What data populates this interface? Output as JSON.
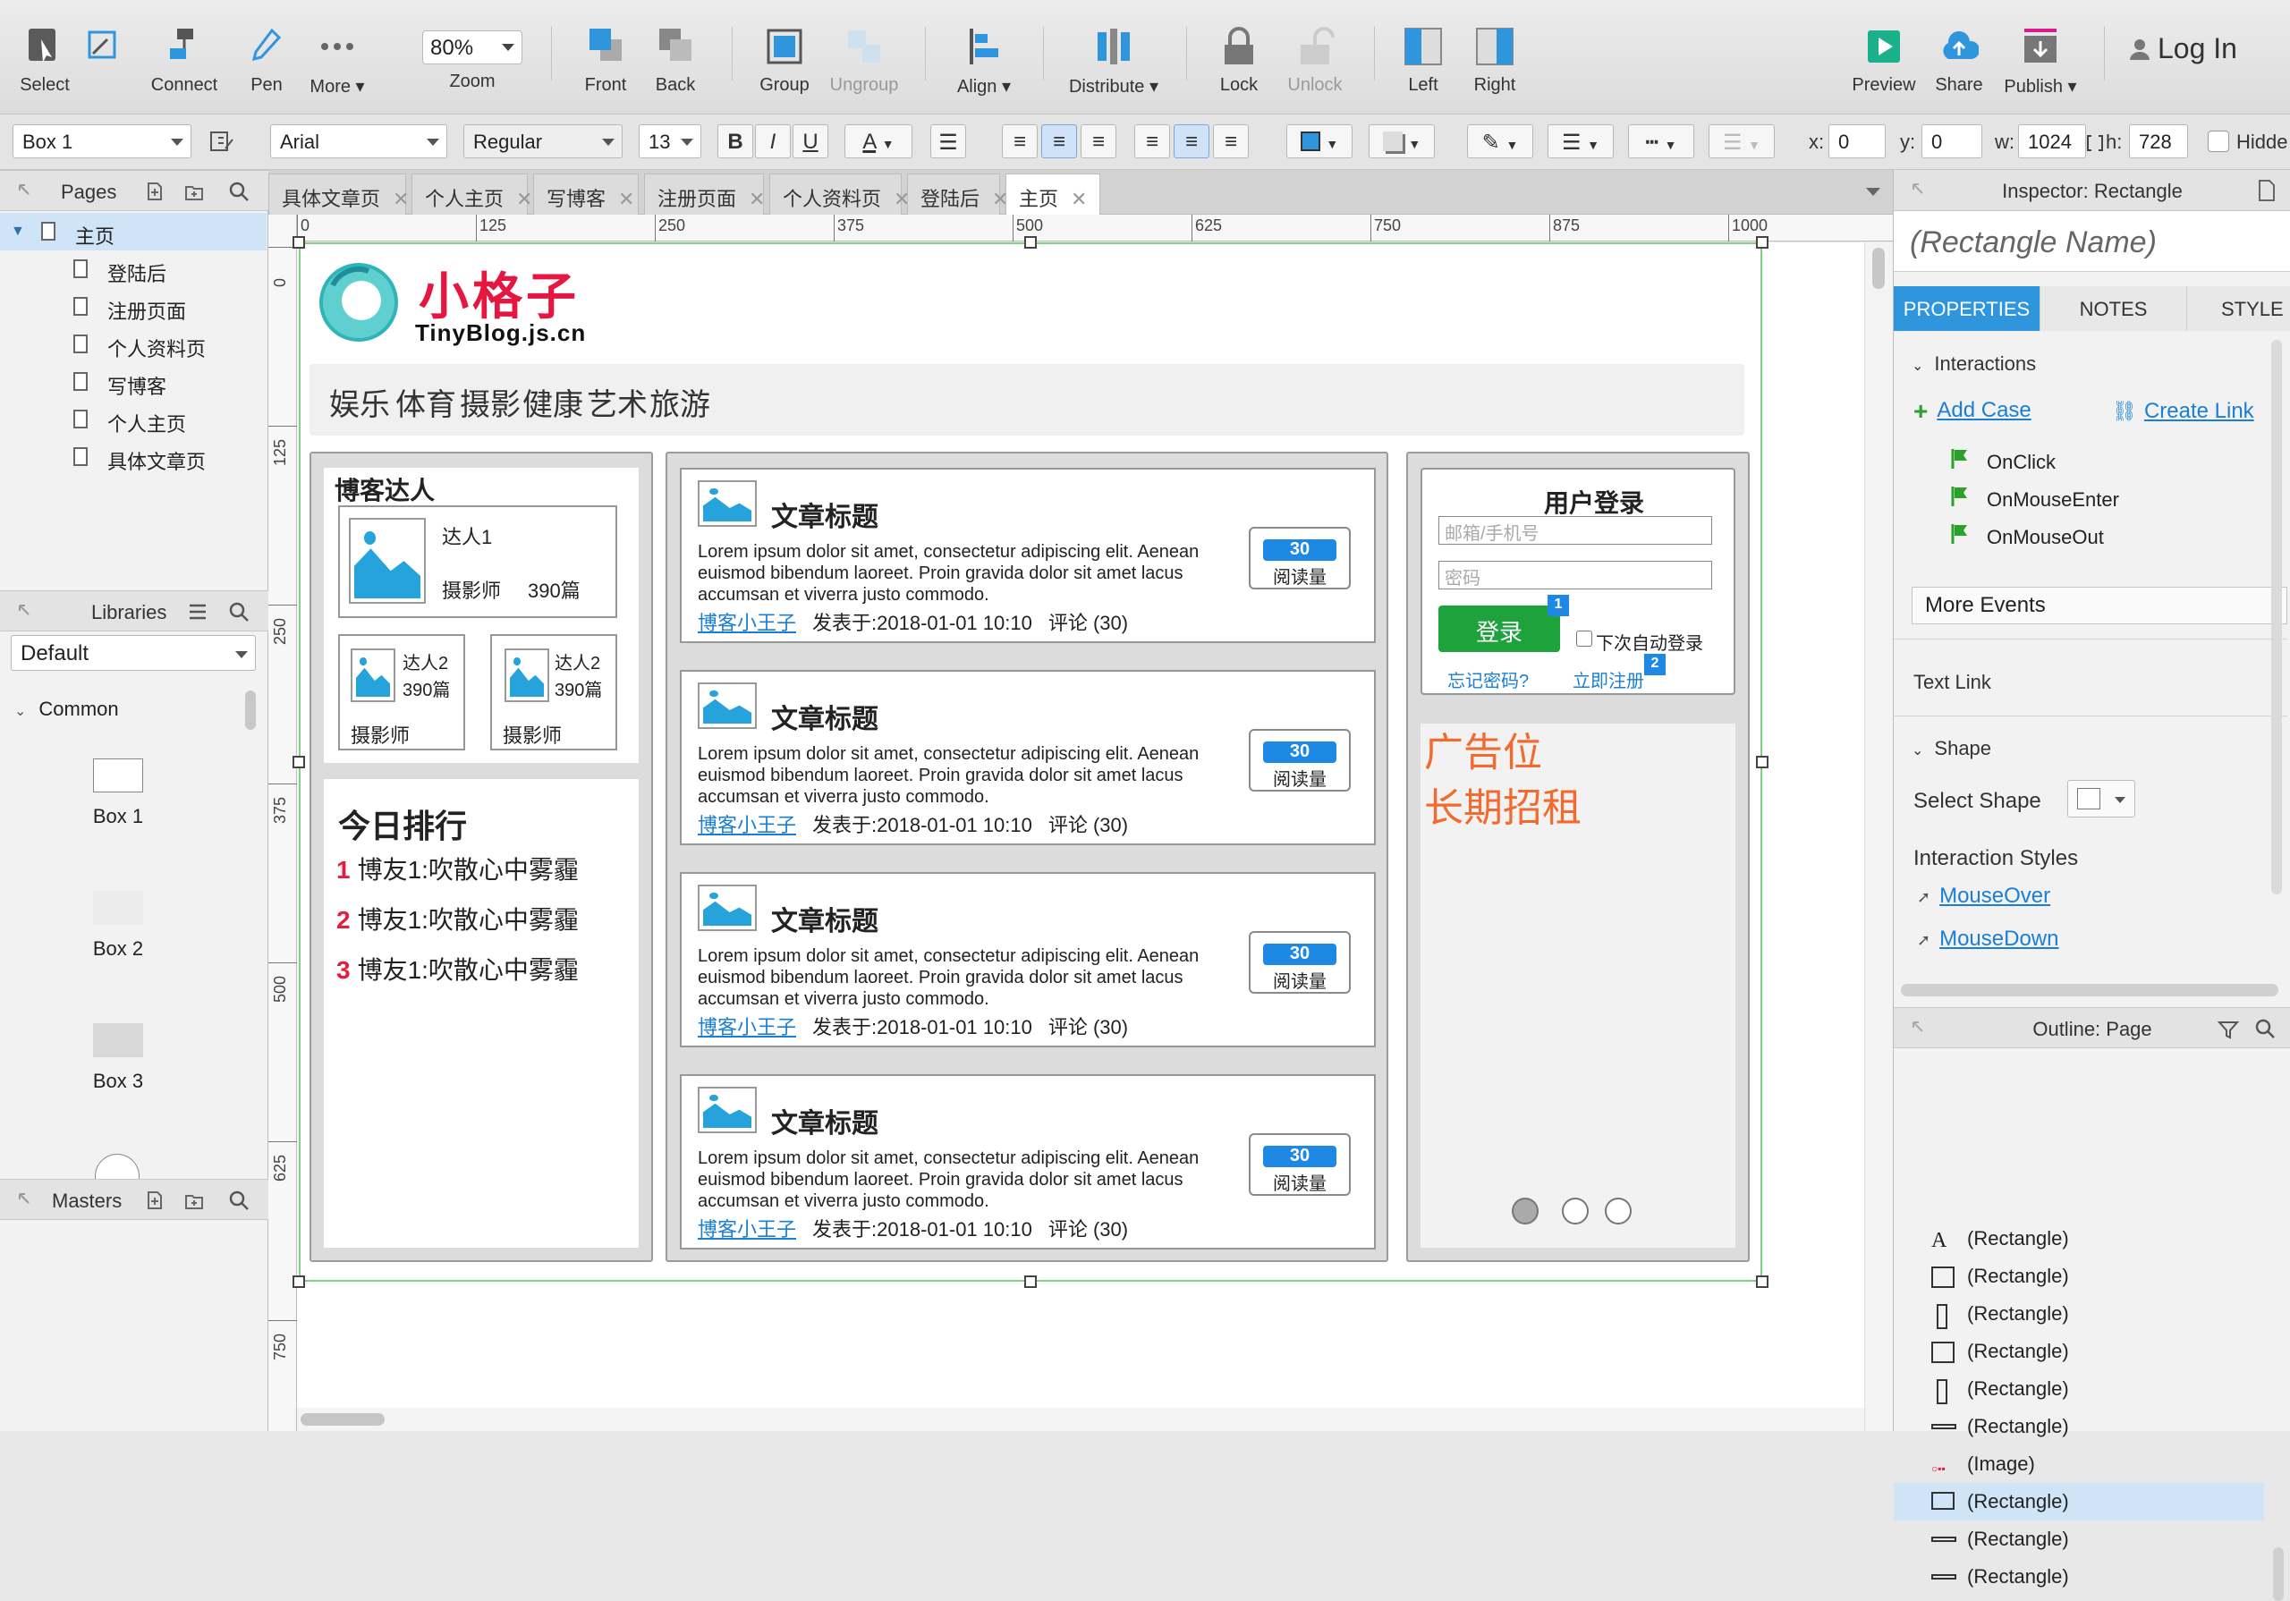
{
  "toolbar": {
    "select": "Select",
    "connect": "Connect",
    "pen": "Pen",
    "more": "More ▾",
    "zoom_value": "80%",
    "zoom_label": "Zoom",
    "front": "Front",
    "back": "Back",
    "group": "Group",
    "ungroup": "Ungroup",
    "align": "Align ▾",
    "distribute": "Distribute ▾",
    "lock": "Lock",
    "unlock": "Unlock",
    "left": "Left",
    "right": "Right",
    "preview": "Preview",
    "share": "Share",
    "publish": "Publish ▾",
    "login": "Log In"
  },
  "format": {
    "widget": "Box 1",
    "font": "Arial",
    "weight": "Regular",
    "size": "13",
    "x_label": "x:",
    "x": "0",
    "y_label": "y:",
    "y": "0",
    "w_label": "w:",
    "w": "1024",
    "h_label": "h:",
    "h": "728",
    "hidden": "Hidde"
  },
  "pages_panel": {
    "title": "Pages",
    "root": "主页",
    "pages": [
      "登陆后",
      "注册页面",
      "个人资料页",
      "写博客",
      "个人主页",
      "具体文章页"
    ]
  },
  "libraries_panel": {
    "title": "Libraries",
    "selected": "Default",
    "group": "Common",
    "widgets": [
      "Box 1",
      "Box 2",
      "Box 3"
    ]
  },
  "masters_panel": {
    "title": "Masters"
  },
  "tabs": [
    "具体文章页",
    "个人主页",
    "写博客",
    "注册页面",
    "个人资料页",
    "登陆后",
    "主页"
  ],
  "ruler": {
    "h": [
      "0",
      "125",
      "250",
      "375",
      "500",
      "625",
      "750",
      "875",
      "1000"
    ],
    "v": [
      "0",
      "125",
      "250",
      "375",
      "500",
      "625",
      "750"
    ]
  },
  "site": {
    "logo_cn": "小格子",
    "logo_en": "TinyBlog.js.cn",
    "nav": [
      "娱乐",
      "体育",
      "摄影",
      "健康",
      "艺术",
      "旅游"
    ],
    "experts_title": "博客达人",
    "expert_main": {
      "name": "达人1",
      "role": "摄影师",
      "count": "390篇"
    },
    "expert_small": [
      {
        "name": "达人2",
        "count": "390篇",
        "role": "摄影师"
      },
      {
        "name": "达人2",
        "count": "390篇",
        "role": "摄影师"
      }
    ],
    "ranking_title": "今日排行",
    "ranking": [
      {
        "num": "1",
        "text": "博友1:吹散心中雾霾"
      },
      {
        "num": "2",
        "text": "博友1:吹散心中雾霾"
      },
      {
        "num": "3",
        "text": "博友1:吹散心中雾霾"
      }
    ],
    "articles": [
      {
        "title": "文章标题",
        "body": "Lorem ipsum dolor sit amet, consectetur adipiscing elit. Aenean euismod bibendum laoreet. Proin gravida dolor sit amet lacus accumsan et viverra justo commodo.",
        "author": "博客小王子",
        "date": "发表于:2018-01-01 10:10",
        "comments": "评论 (30)",
        "reads": "30",
        "reads_label": "阅读量"
      },
      {
        "title": "文章标题",
        "body": "Lorem ipsum dolor sit amet, consectetur adipiscing elit. Aenean euismod bibendum laoreet. Proin gravida dolor sit amet lacus accumsan et viverra justo commodo.",
        "author": "博客小王子",
        "date": "发表于:2018-01-01 10:10",
        "comments": "评论 (30)",
        "reads": "30",
        "reads_label": "阅读量"
      },
      {
        "title": "文章标题",
        "body": "Lorem ipsum dolor sit amet, consectetur adipiscing elit. Aenean euismod bibendum laoreet. Proin gravida dolor sit amet lacus accumsan et viverra justo commodo.",
        "author": "博客小王子",
        "date": "发表于:2018-01-01 10:10",
        "comments": "评论 (30)",
        "reads": "30",
        "reads_label": "阅读量"
      },
      {
        "title": "文章标题",
        "body": "Lorem ipsum dolor sit amet, consectetur adipiscing elit. Aenean euismod bibendum laoreet. Proin gravida dolor sit amet lacus accumsan et viverra justo commodo.",
        "author": "博客小王子",
        "date": "发表于:2018-01-01 10:10",
        "comments": "评论 (30)",
        "reads": "30",
        "reads_label": "阅读量"
      }
    ],
    "login": {
      "title": "用户登录",
      "user_placeholder": "邮箱/手机号",
      "pass_placeholder": "密码",
      "button": "登录",
      "remember": "下次自动登录",
      "forgot": "忘记密码?",
      "register": "立即注册",
      "marker1": "1",
      "marker2": "2"
    },
    "ad": {
      "line1": "广告位",
      "line2": "长期招租"
    }
  },
  "inspector": {
    "title": "Inspector: Rectangle",
    "name_placeholder": "(Rectangle Name)",
    "tabs": [
      "PROPERTIES",
      "NOTES",
      "STYLE"
    ],
    "interactions": "Interactions",
    "add_case": "Add Case",
    "create_link": "Create Link",
    "events": [
      "OnClick",
      "OnMouseEnter",
      "OnMouseOut"
    ],
    "more_events": "More Events",
    "text_link": "Text Link",
    "shape": "Shape",
    "select_shape": "Select Shape",
    "interaction_styles": "Interaction Styles",
    "styles": [
      "MouseOver",
      "MouseDown"
    ]
  },
  "outline": {
    "title": "Outline: Page",
    "items": [
      "(Rectangle)",
      "(Rectangle)",
      "(Rectangle)",
      "(Rectangle)",
      "(Rectangle)",
      "(Rectangle)",
      "(Image)",
      "(Rectangle)",
      "(Rectangle)",
      "(Rectangle)"
    ]
  },
  "colors": {
    "accent": "#2f96dd",
    "login_green": "#1ea23c",
    "ad_orange": "#f26a2d",
    "logo_red": "#e5163f",
    "link_blue": "#1a7fd4"
  }
}
